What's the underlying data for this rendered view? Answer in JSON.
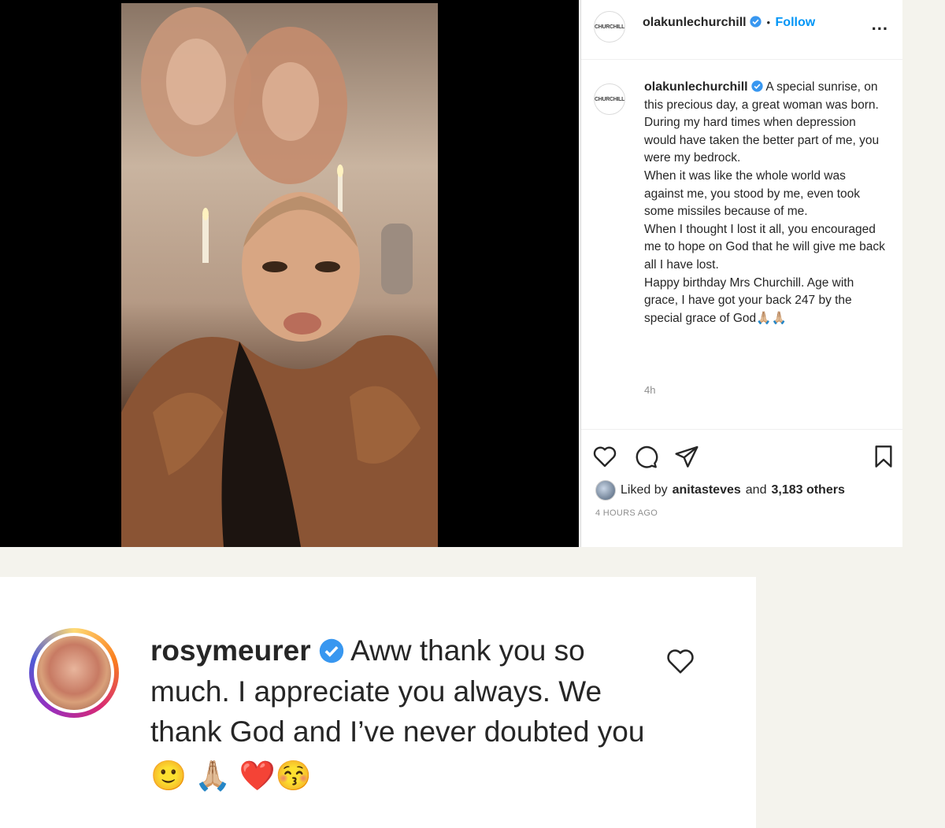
{
  "post": {
    "username": "olakunlechurchill",
    "follow_separator": "•",
    "follow_label": "Follow",
    "more_label": "...",
    "logo_text": "CHURCHILL",
    "caption": "A special sunrise, on this precious day, a great woman was born.\nDuring my hard times when depression would have taken the better part of me, you were my bedrock.\nWhen it was like the whole world was against me, you stood by me, even took some missiles because of me.\nWhen I thought I lost it all, you encouraged me to hope on God that he will give me back all I have lost.\nHappy birthday Mrs Churchill. Age with grace, I have got your back 247 by the special grace of God",
    "caption_emoji": "🙏🏼🙏🏼",
    "caption_time": "4h",
    "liked_prefix": "Liked by",
    "liked_user": "anitasteves",
    "liked_and": "and",
    "liked_others": "3,183 others",
    "time_ago": "4 HOURS AGO"
  },
  "comment": {
    "username": "rosymeurer",
    "text": "Aww thank you so much. I appreciate you always. We thank God and I’ve never doubted you",
    "emojis": "🙂 🙏🏼 ❤️😚"
  },
  "colors": {
    "link_blue": "#0095f6",
    "verified_blue": "#3897f0",
    "background": "#f4f3ed"
  },
  "icons": {
    "verified": "verified-badge-icon",
    "like": "heart-icon",
    "comment": "comment-bubble-icon",
    "share": "paper-plane-icon",
    "save": "bookmark-icon",
    "more": "more-dots-icon"
  }
}
